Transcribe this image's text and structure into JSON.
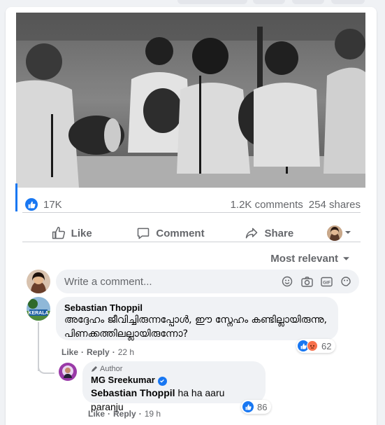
{
  "post": {
    "stats": {
      "like_count": "17K",
      "comments": "1.2K comments",
      "shares": "254 shares"
    },
    "actions": {
      "like": "Like",
      "comment": "Comment",
      "share": "Share"
    },
    "sort_label": "Most relevant"
  },
  "composer": {
    "placeholder": "Write a comment..."
  },
  "comments": [
    {
      "author": "Sebastian Thoppil",
      "text": "അദ്ദേഹം ജീവിച്ചിരുന്നപ്പോൾ, ഈ സ്നേഹം കണ്ടില്ലായിരുന്നു, പിണക്കത്തിലല്ലായിരുന്നോ?",
      "like": "Like",
      "reply": "Reply",
      "time": "22 h",
      "reaction_count": "62",
      "avatar_label": "KERALA"
    },
    {
      "author_tag": "Author",
      "author": "MG Sreekumar",
      "mention": "Sebastian Thoppil",
      "text": " ha ha aaru paranju",
      "like": "Like",
      "reply": "Reply",
      "time": "19 h",
      "reaction_count": "86"
    }
  ],
  "colors": {
    "brand_blue": "#1877f2",
    "secondary_text": "#65676b",
    "bubble_bg": "#f0f2f5",
    "angry_orange": "#f7714c"
  }
}
